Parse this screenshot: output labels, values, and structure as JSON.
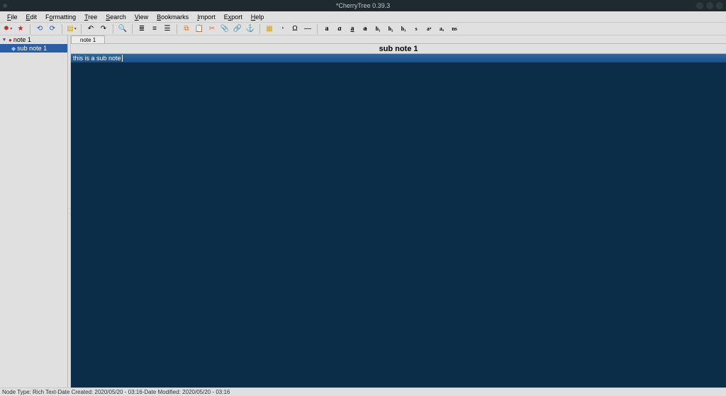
{
  "window": {
    "title": "*CherryTree 0.39.3"
  },
  "menubar": [
    "File",
    "Edit",
    "Formatting",
    "Tree",
    "Search",
    "View",
    "Bookmarks",
    "Import",
    "Export",
    "Help"
  ],
  "tree": {
    "items": [
      {
        "label": "note 1",
        "selected": false
      },
      {
        "label": "sub note 1",
        "selected": true
      }
    ]
  },
  "tabs": [
    {
      "label": "note 1"
    }
  ],
  "node_title": "sub note 1",
  "editor": {
    "content": "this is a sub note"
  },
  "statusbar": {
    "node_type_label": "Node Type:",
    "node_type": "Rich Text",
    "sep": "  -  ",
    "created_label": "Date Created:",
    "created": "2020/05/20 - 03:16",
    "modified_label": "Date Modified:",
    "modified": "2020/05/20 - 03:16"
  },
  "toolbar_format": {
    "h1": "h₁",
    "h2": "h₂",
    "h3": "h₃",
    "small": "s",
    "sup": "aᵃ",
    "sub": "aₐ",
    "ns": "ns"
  }
}
